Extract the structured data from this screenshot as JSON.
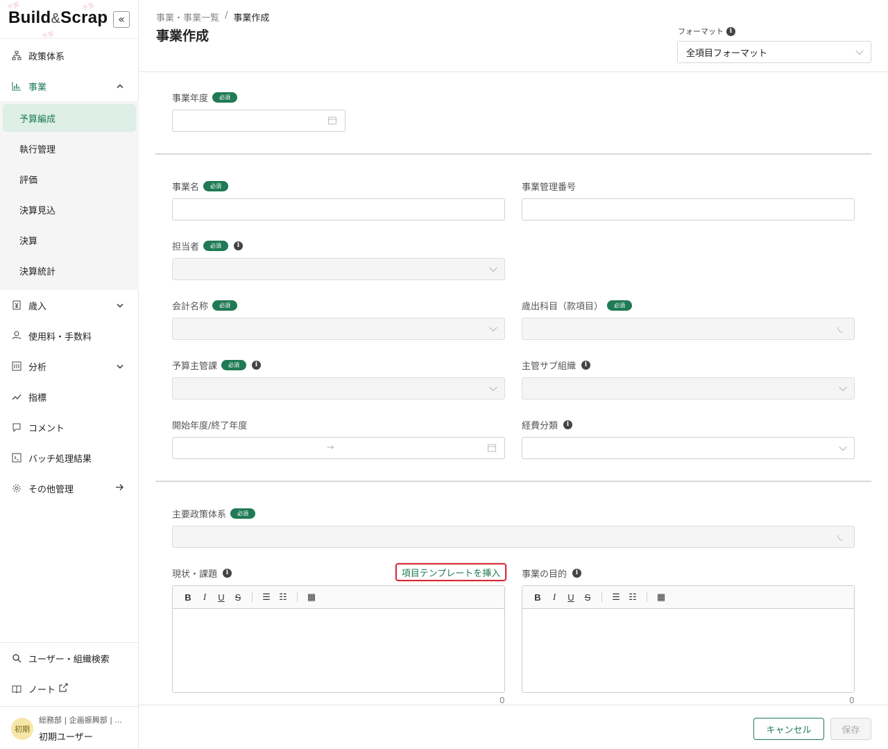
{
  "sidebar": {
    "logo_main": "Build",
    "logo_amp": "&",
    "logo_end": "Scrap",
    "logo_stamp": "予算",
    "collapse_label": "«",
    "items": [
      {
        "label": "政策体系",
        "icon": "hierarchy-icon"
      },
      {
        "label": "事業",
        "icon": "chart-icon",
        "expanded": true
      },
      {
        "label": "歳入",
        "icon": "yen-document-icon"
      },
      {
        "label": "使用料・手数料",
        "icon": "hand-coin-icon"
      },
      {
        "label": "分析",
        "icon": "analysis-icon"
      },
      {
        "label": "指標",
        "icon": "trend-icon"
      },
      {
        "label": "コメント",
        "icon": "comment-icon"
      },
      {
        "label": "バッチ処理結果",
        "icon": "terminal-icon"
      },
      {
        "label": "その他管理",
        "icon": "gear-icon"
      }
    ],
    "sub_items": [
      {
        "label": "予算編成",
        "active": true
      },
      {
        "label": "執行管理"
      },
      {
        "label": "評価"
      },
      {
        "label": "決算見込"
      },
      {
        "label": "決算"
      },
      {
        "label": "決算統計"
      }
    ],
    "bottom_items": [
      {
        "label": "ユーザー・組織検索",
        "icon": "search-icon"
      },
      {
        "label": "ノート",
        "icon": "book-icon"
      }
    ],
    "user": {
      "avatar_text": "初期",
      "org": "総務部 | 企画振興部 | ...",
      "name": "初期ユーザー"
    }
  },
  "header": {
    "breadcrumb_parent": "事業・事業一覧",
    "breadcrumb_sep": "/",
    "breadcrumb_current": "事業作成",
    "title": "事業作成",
    "format_label": "フォーマット",
    "format_value": "全項目フォーマット"
  },
  "form": {
    "required_badge": "必須",
    "fiscal_year": "事業年度",
    "business_name": "事業名",
    "business_number": "事業管理番号",
    "person_in_charge": "担当者",
    "account_name": "会計名称",
    "expense_item": "歳出科目（款項目）",
    "budget_dept": "予算主管課",
    "sub_org": "主管サブ組織",
    "period": "開始年度/終了年度",
    "period_arrow": "→",
    "expense_class": "経費分類",
    "main_policy": "主要政策体系",
    "current_issues": "現状・課題",
    "insert_template": "項目テンプレートを挿入",
    "purpose": "事業の目的",
    "char_count_left": "0",
    "char_count_right": "0"
  },
  "toolbar": {
    "bold": "B",
    "italic": "I",
    "underline": "U",
    "strike": "S",
    "bullet": "☰",
    "numbered": "☷",
    "table": "▦"
  },
  "footer": {
    "cancel": "キャンセル",
    "save": "保存"
  }
}
